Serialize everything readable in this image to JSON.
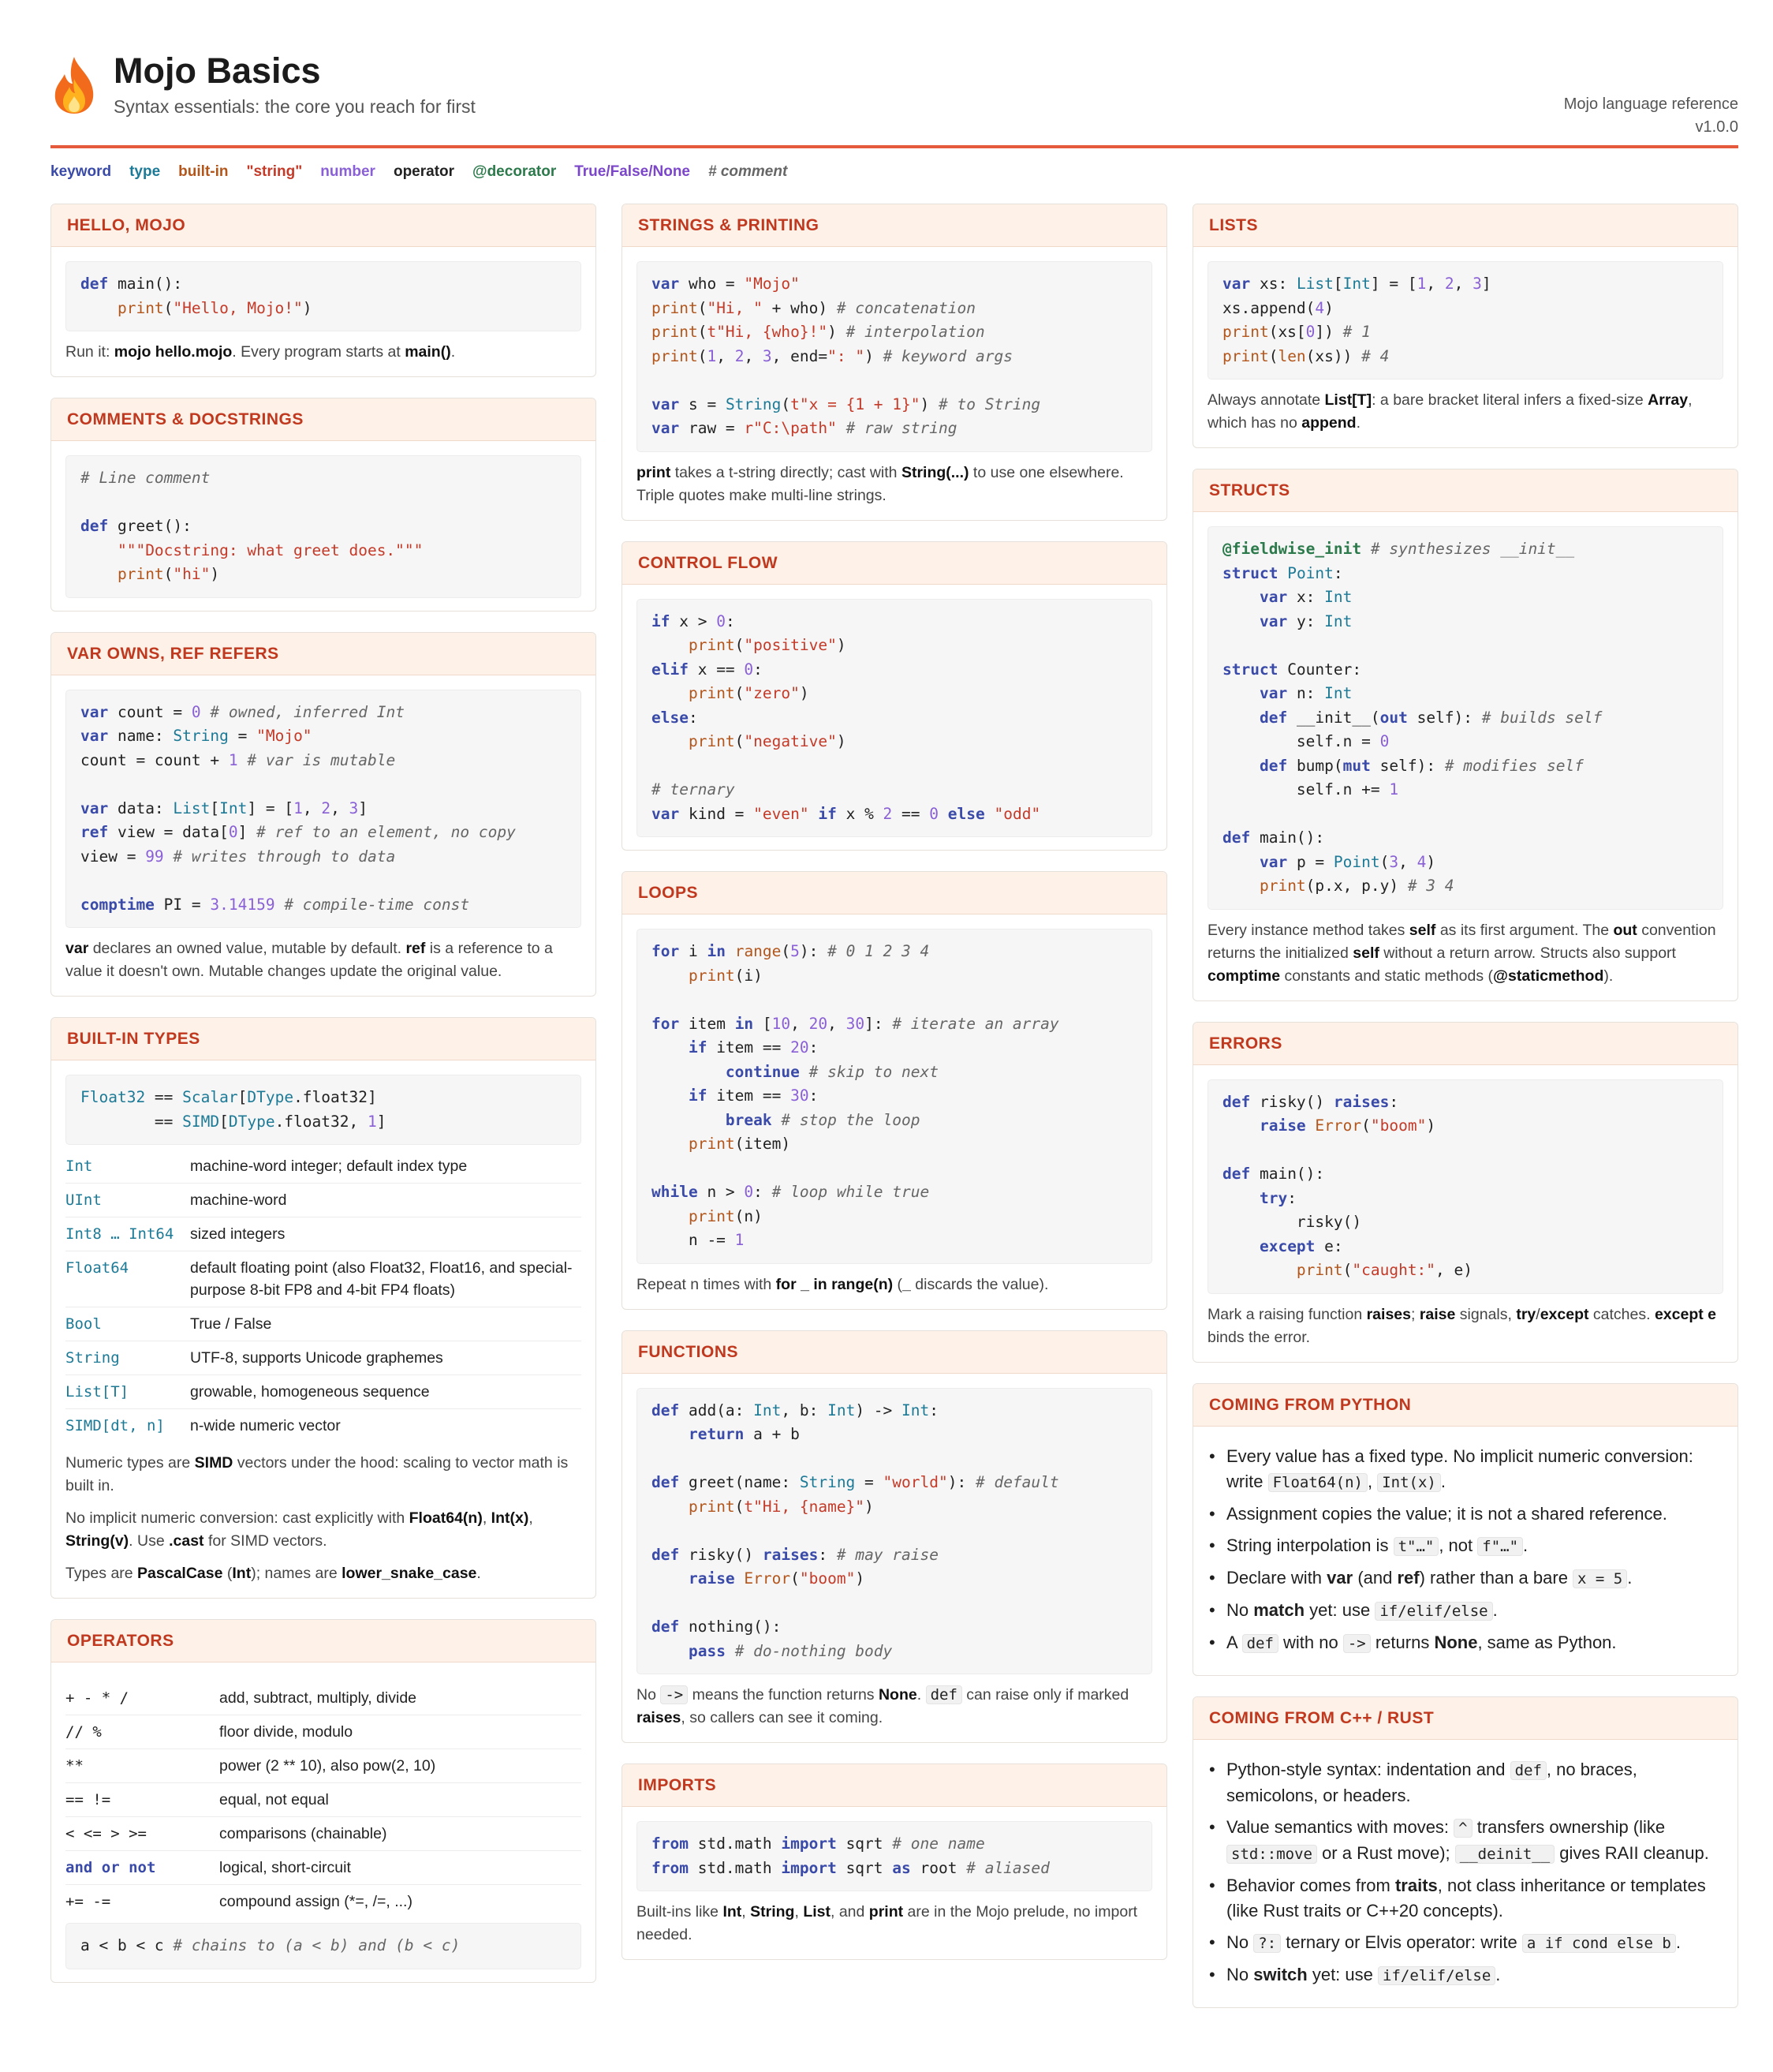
{
  "header": {
    "title": "Mojo Basics",
    "subtitle": "Syntax essentials: the core you reach for first",
    "ref_line1": "Mojo language reference",
    "ref_line2": "v1.0.0"
  },
  "legend": {
    "keyword": "keyword",
    "type": "type",
    "builtin": "built-in",
    "string": "\"string\"",
    "number": "number",
    "operator": "operator",
    "decorator": "@decorator",
    "bool": "True/False/None",
    "comment": "# comment"
  },
  "cards": {
    "hello": {
      "title": "HELLO, MOJO"
    },
    "comments": {
      "title": "COMMENTS & DOCSTRINGS"
    },
    "var": {
      "title": "VAR OWNS, REF REFERS"
    },
    "builtin": {
      "title": "BUILT-IN TYPES",
      "rows": [
        {
          "k": "Int",
          "v": "machine-word integer; default index type"
        },
        {
          "k": "UInt",
          "v": "machine-word"
        },
        {
          "k": "Int8 … Int64",
          "v": "sized integers"
        },
        {
          "k": "Float64",
          "v": "default floating point (also Float32, Float16, and special-purpose 8-bit FP8 and 4-bit FP4 floats)"
        },
        {
          "k": "Bool",
          "v": "True / False"
        },
        {
          "k": "String",
          "v": "UTF-8, supports Unicode graphemes"
        },
        {
          "k": "List[T]",
          "v": "growable, homogeneous sequence"
        },
        {
          "k": "SIMD[dt, n]",
          "v": "n-wide numeric vector"
        }
      ]
    },
    "operators": {
      "title": "OPERATORS",
      "rows": [
        {
          "k": "+ - * /",
          "v": "add, subtract, multiply, divide"
        },
        {
          "k": "//  %",
          "v": "floor divide, modulo"
        },
        {
          "k": "**",
          "v": "power (2 ** 10), also pow(2, 10)"
        },
        {
          "k": "== !=",
          "v": "equal, not equal"
        },
        {
          "k": "< <= > >=",
          "v": "comparisons (chainable)"
        },
        {
          "k": "and or not",
          "v": "logical, short-circuit"
        },
        {
          "k": "+= -=",
          "v": "compound assign (*=, /=, ...)"
        }
      ]
    },
    "strings": {
      "title": "STRINGS & PRINTING"
    },
    "control": {
      "title": "CONTROL FLOW"
    },
    "loops": {
      "title": "LOOPS"
    },
    "functions": {
      "title": "FUNCTIONS"
    },
    "imports": {
      "title": "IMPORTS"
    },
    "lists": {
      "title": "LISTS"
    },
    "structs": {
      "title": "STRUCTS"
    },
    "errors": {
      "title": "ERRORS"
    },
    "python": {
      "title": "COMING FROM PYTHON"
    },
    "cpp": {
      "title": "COMING FROM C++ / RUST"
    }
  },
  "colors": {
    "accent": "#e55a3c",
    "card_header_bg": "#fdf1e8",
    "card_header_text": "#c0391f",
    "keyword": "#3a4aa8",
    "type": "#1d7a96",
    "builtin": "#b3561c",
    "string": "#c43a28",
    "number": "#8a60d6",
    "decorator": "#2c7a4b"
  },
  "icons": {
    "logo": "flame-icon"
  }
}
